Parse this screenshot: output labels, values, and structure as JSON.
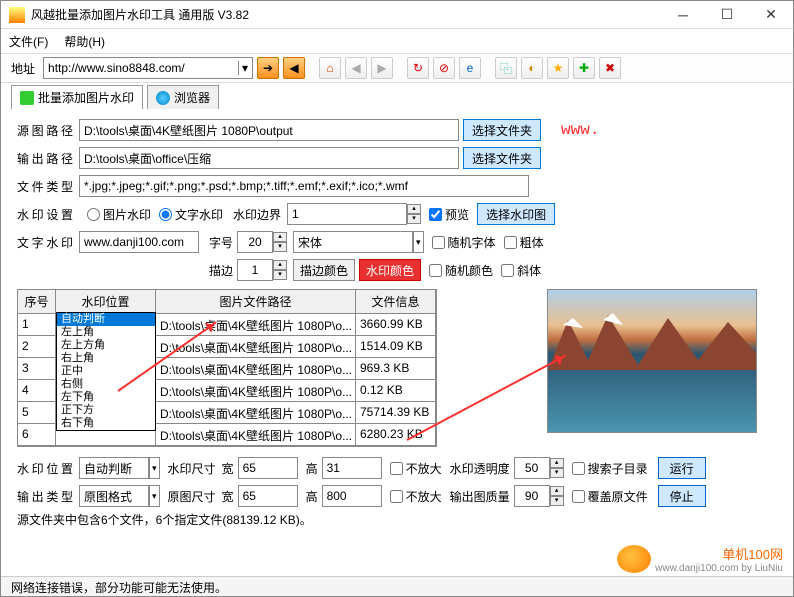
{
  "window": {
    "title": "风越批量添加图片水印工具 通用版 V3.82"
  },
  "menu": {
    "file": "文件(F)",
    "help": "帮助(H)"
  },
  "address": {
    "label": "地址",
    "url": "http://www.sino8848.com/"
  },
  "tabs": {
    "main": "批量添加图片水印",
    "browser": "浏览器"
  },
  "labels": {
    "srcPath": "源图路径",
    "outPath": "输出路径",
    "fileType": "文件类型",
    "wmSetting": "水印设置",
    "wmBorder": "水印边界",
    "preview": "预览",
    "textWm": "文字水印",
    "fontSize": "字号",
    "stroke": "描边",
    "strokeColor": "描边颜色",
    "wmColor": "水印颜色",
    "randFont": "随机字体",
    "bold": "粗体",
    "randColor": "随机颜色",
    "italic": "斜体",
    "picWm": "图片水印",
    "txtWm": "文字水印",
    "wmPos": "水印位置",
    "wmSize": "水印尺寸",
    "width": "宽",
    "height": "高",
    "noEnlarge": "不放大",
    "opacity": "水印透明度",
    "searchSub": "搜索子目录",
    "outType": "输出类型",
    "origFmt": "原图格式",
    "origSize": "原图尺寸",
    "outQuality": "输出图质量",
    "overwrite": "覆盖原文件",
    "run": "运行",
    "stop": "停止",
    "selectFolder": "选择文件夹",
    "selectWmImg": "选择水印图"
  },
  "paths": {
    "src": "D:\\tools\\桌面\\4K壁纸图片 1080P\\output",
    "out": "D:\\tools\\桌面\\office\\压缩",
    "types": "*.jpg;*.jpeg;*.gif;*.png;*.psd;*.bmp;*.tiff;*.emf;*.exif;*.ico;*.wmf"
  },
  "wm": {
    "border": "1",
    "text": "www.danji100.com",
    "fontSize": "20",
    "font": "宋体",
    "stroke": "1"
  },
  "www": "www.",
  "table": {
    "headers": {
      "idx": "序号",
      "pos": "水印位置",
      "path": "图片文件路径",
      "info": "文件信息"
    },
    "rows": [
      {
        "idx": "1",
        "pos": "自动判断",
        "path": "D:\\tools\\桌面\\4K壁纸图片 1080P\\o...",
        "info": "3660.99 KB"
      },
      {
        "idx": "2",
        "pos": "",
        "path": "D:\\tools\\桌面\\4K壁纸图片 1080P\\o...",
        "info": "1514.09 KB"
      },
      {
        "idx": "3",
        "pos": "",
        "path": "D:\\tools\\桌面\\4K壁纸图片 1080P\\o...",
        "info": "969.3 KB"
      },
      {
        "idx": "4",
        "pos": "",
        "path": "D:\\tools\\桌面\\4K壁纸图片 1080P\\o...",
        "info": "0.12 KB"
      },
      {
        "idx": "5",
        "pos": "",
        "path": "D:\\tools\\桌面\\4K壁纸图片 1080P\\o...",
        "info": "75714.39 KB"
      },
      {
        "idx": "6",
        "pos": "",
        "path": "D:\\tools\\桌面\\4K壁纸图片 1080P\\o...",
        "info": "6280.23 KB"
      }
    ],
    "dropdown": [
      "自动判断",
      "左上角",
      "左上方角",
      "右上角",
      "正中",
      "右侧",
      "左下角",
      "正下方",
      "右下角"
    ]
  },
  "bottom": {
    "wmPos": "自动判断",
    "w": "65",
    "h": "31",
    "opacity": "50",
    "origW": "65",
    "origH": "800",
    "quality": "90",
    "summary": "源文件夹中包含6个文件，6个指定文件(88139.12 KB)。"
  },
  "status": "网络连接错误，部分功能可能无法使用。",
  "brand": {
    "name": "单机100网",
    "url": "www.danji100.com",
    "by": "by LiuNiu"
  }
}
